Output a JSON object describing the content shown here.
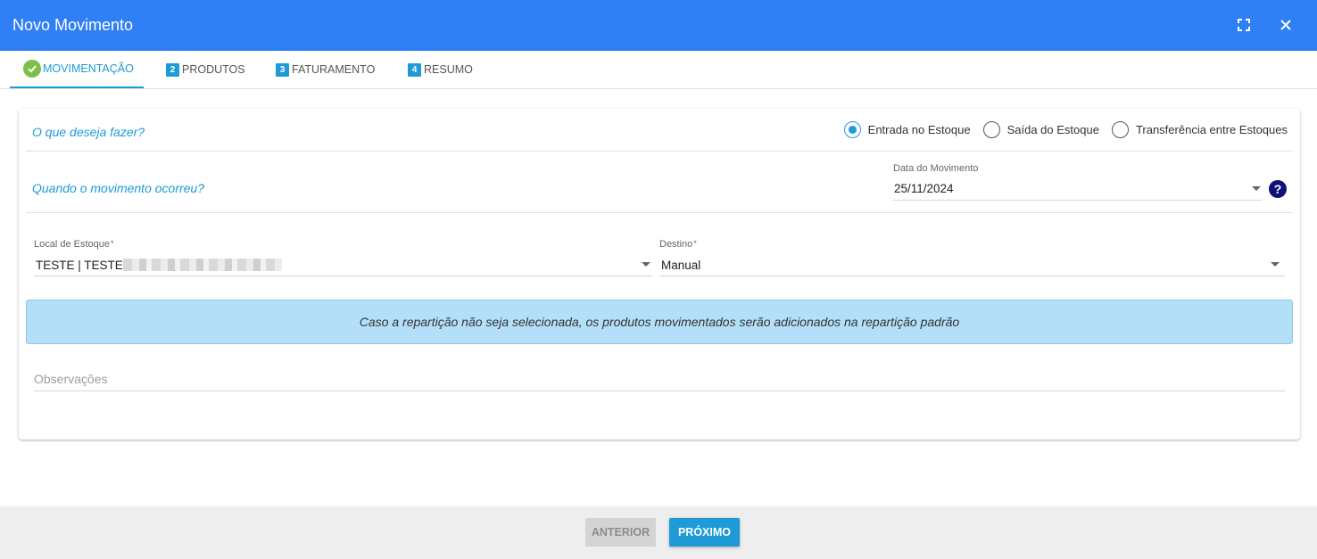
{
  "dialog": {
    "title": "Novo Movimento",
    "icons": {
      "fullscreen": "fullscreen-icon",
      "close": "close-icon"
    }
  },
  "tabs": [
    {
      "label": "MOVIMENTAÇÃO",
      "marker": "check-icon",
      "active": true
    },
    {
      "label": "PRODUTOS",
      "marker": "2"
    },
    {
      "label": "FATURAMENTO",
      "marker": "3"
    },
    {
      "label": "RESUMO",
      "marker": "4"
    }
  ],
  "form": {
    "question_action": "O que deseja fazer?",
    "radios": [
      {
        "label": "Entrada no Estoque",
        "checked": true
      },
      {
        "label": "Saída do Estoque",
        "checked": false
      },
      {
        "label": "Transferência entre Estoques",
        "checked": false
      }
    ],
    "question_when": "Quando o movimento ocorreu?",
    "date": {
      "label": "Data do Movimento",
      "value": "25/11/2024",
      "help": "?"
    },
    "local": {
      "label": "Local de Estoque",
      "required": "*",
      "value": "TESTE | TESTE"
    },
    "destino": {
      "label": "Destino",
      "required": "*",
      "value": "Manual"
    },
    "info_message": "Caso a repartição não seja selecionada, os produtos movimentados serão adicionados na repartição padrão",
    "observacoes": {
      "placeholder": "Observações"
    }
  },
  "footer": {
    "prev_label": "ANTERIOR",
    "next_label": "PRÓXIMO"
  },
  "colors": {
    "header": "#2f7ff5",
    "accent": "#1e9bd7",
    "info_bg": "#b3e0f8",
    "check": "#7cc04b"
  }
}
